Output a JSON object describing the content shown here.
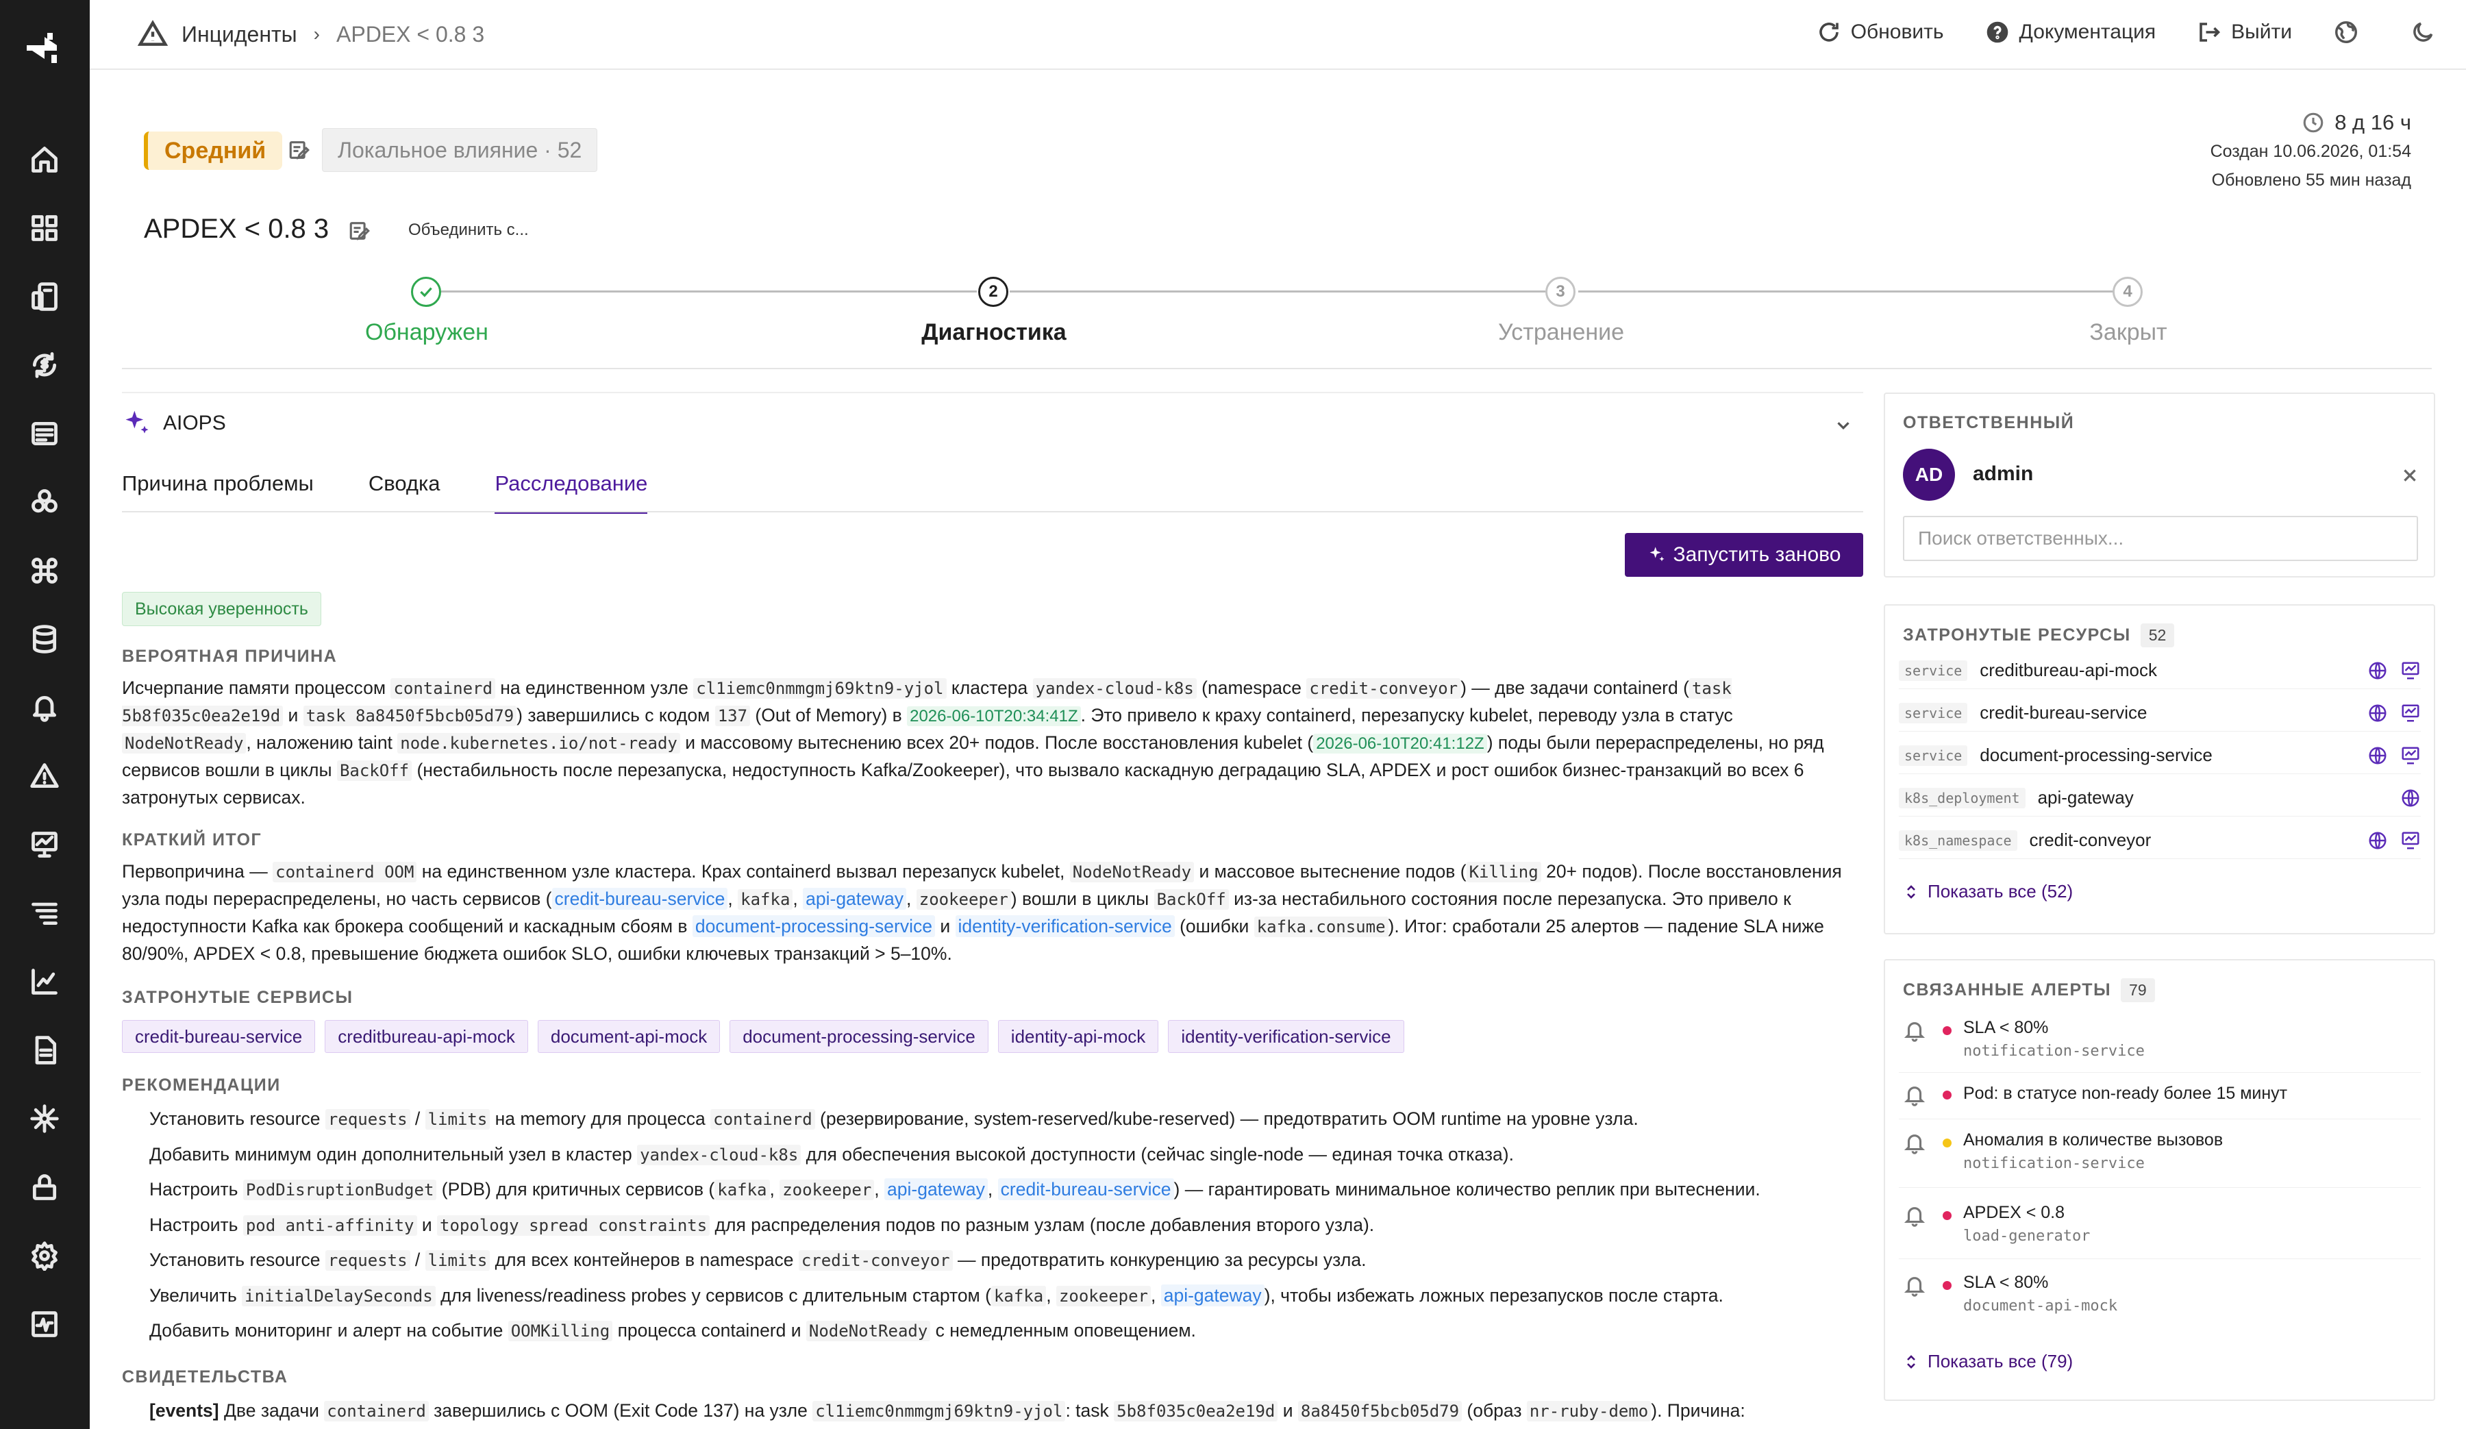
{
  "breadcrumb": {
    "section": "Инциденты",
    "current": "APDEX < 0.8 3"
  },
  "topbar": {
    "refresh": "Обновить",
    "docs": "Документация",
    "logout": "Выйти"
  },
  "incident": {
    "severity": "Средний",
    "impact": "Локальное влияние · 52",
    "title": "APDEX < 0.8 3",
    "merge": "Объединить с...",
    "duration": "8 д 16 ч",
    "created": "Создан 10.06.2026, 01:54",
    "updated": "Обновлено 55 мин назад"
  },
  "stepper": [
    {
      "num": "",
      "label": "Обнаружен",
      "state": "done"
    },
    {
      "num": "2",
      "label": "Диагностика",
      "state": "active"
    },
    {
      "num": "3",
      "label": "Устранение",
      "state": "pending"
    },
    {
      "num": "4",
      "label": "Закрыт",
      "state": "pending"
    }
  ],
  "aiops": {
    "title": "AIOPS",
    "tabs": [
      "Причина проблемы",
      "Сводка",
      "Расследование"
    ],
    "active_tab": "Расследование",
    "rerun": "Запустить заново",
    "confidence": "Высокая уверенность",
    "cause_heading": "ВЕРОЯТНАЯ ПРИЧИНА",
    "cause": {
      "t1": "Исчерпание памяти процессом ",
      "c1": "containerd",
      "t2": " на единственном узле ",
      "c2": "cl1iemc0nmmgmj69ktn9-yjol",
      "t3": " кластера ",
      "c3": "yandex-cloud-k8s",
      "t4": " (namespace ",
      "c4": "credit-conveyor",
      "t5": ") — две задачи containerd (",
      "c5": "task 5b8f035c0ea2e19d",
      "t6": " и ",
      "c6": "task 8a8450f5bcb05d79",
      "t7": ") завершились с кодом ",
      "c7": "137",
      "t8": " (Out of Memory) в ",
      "ts1": "2026-06-10T20:34:41Z",
      "t9": ". Это привело к краху containerd, перезапуску kubelet, переводу узла в статус ",
      "c8": "NodeNotReady",
      "t10": ", наложению taint ",
      "c9": "node.kubernetes.io/not-ready",
      "t11": " и массовому вытеснению всех 20+ подов. После восстановления kubelet (",
      "ts2": "2026-06-10T20:41:12Z",
      "t12": ") поды были перераспределены, но ряд сервисов вошли в циклы ",
      "c10": "BackOff",
      "t13": " (нестабильность после перезапуска, недоступность Kafka/Zookeeper), что вызвало каскадную деградацию SLA, APDEX и рост ошибок бизнес-транзакций во всех 6 затронутых сервисах."
    },
    "summary_heading": "КРАТКИЙ ИТОГ",
    "summary": {
      "t1": "Первопричина — ",
      "c1": "containerd OOM",
      "t2": " на единственном узле кластера. Крах containerd вызвал перезапуск kubelet, ",
      "c2": "NodeNotReady",
      "t3": " и массовое вытеснение подов (",
      "c3": "Killing",
      "t4": " 20+ подов). После восстановления узла поды перераспределены, но часть сервисов (",
      "l1": "credit-bureau-service",
      "t5": ", ",
      "c4": "kafka",
      "t6": ", ",
      "l2": "api-gateway",
      "t7": ", ",
      "c5": "zookeeper",
      "t8": ") вошли в циклы ",
      "c6": "BackOff",
      "t9": " из-за нестабильного состояния после перезапуска. Это привело к недоступности Kafka как брокера сообщений и каскадным сбоям в ",
      "l3": "document-processing-service",
      "t10": " и ",
      "l4": "identity-verification-service",
      "t11": " (ошибки ",
      "c7": "kafka.consume",
      "t12": "). Итог: сработали 25 алертов — падение SLA ниже 80/90%, APDEX < 0.8, превышение бюджета ошибок SLO, ошибки ключевых транзакций > 5–10%."
    },
    "services_heading": "ЗАТРОНУТЫЕ СЕРВИСЫ",
    "services": [
      "credit-bureau-service",
      "creditbureau-api-mock",
      "document-api-mock",
      "document-processing-service",
      "identity-api-mock",
      "identity-verification-service"
    ],
    "rec_heading": "РЕКОМЕНДАЦИИ",
    "recs": {
      "r1": {
        "t1": "Установить resource ",
        "c1": "requests",
        "t2": " / ",
        "c2": "limits",
        "t3": " на memory для процесса ",
        "c3": "containerd",
        "t4": " (резервирование, system-reserved/kube-reserved) — предотвратить OOM runtime на уровне узла."
      },
      "r2": {
        "t1": "Добавить минимум один дополнительный узел в кластер ",
        "c1": "yandex-cloud-k8s",
        "t2": " для обеспечения высокой доступности (сейчас single-node — единая точка отказа)."
      },
      "r3": {
        "t1": "Настроить ",
        "c1": "PodDisruptionBudget",
        "t2": " (PDB) для критичных сервисов (",
        "c2": "kafka",
        "t3": ", ",
        "c3": "zookeeper",
        "t4": ", ",
        "l1": "api-gateway",
        "t5": ", ",
        "l2": "credit-bureau-service",
        "t6": ") — гарантировать минимальное количество реплик при вытеснении."
      },
      "r4": {
        "t1": "Настроить ",
        "c1": "pod anti-affinity",
        "t2": " и ",
        "c2": "topology spread constraints",
        "t3": " для распределения подов по разным узлам (после добавления второго узла)."
      },
      "r5": {
        "t1": "Установить resource ",
        "c1": "requests",
        "t2": " / ",
        "c2": "limits",
        "t3": " для всех контейнеров в namespace ",
        "c3": "credit-conveyor",
        "t4": " — предотвратить конкуренцию за ресурсы узла."
      },
      "r6": {
        "t1": "Увеличить ",
        "c1": "initialDelaySeconds",
        "t2": " для liveness/readiness probes у сервисов с длительным стартом (",
        "c2": "kafka",
        "t3": ", ",
        "c3": "zookeeper",
        "t4": ", ",
        "l1": "api-gateway",
        "t5": "), чтобы избежать ложных перезапусков после старта."
      },
      "r7": {
        "t1": "Добавить мониторинг и алерт на событие ",
        "c1": "OOMKilling",
        "t2": " процесса containerd и ",
        "c2": "NodeNotReady",
        "t3": " с немедленным оповещением."
      }
    },
    "evidence_heading": "СВИДЕТЕЛЬСТВА",
    "evidence": {
      "tag": "[events]",
      "t1": " Две задачи ",
      "c1": "containerd",
      "t2": " завершились с OOM (Exit Code 137) на узле ",
      "c2": "cl1iemc0nmmgmj69ktn9-yjol",
      "t3": ": task ",
      "c3": "5b8f035c0ea2e19d",
      "t4": " и ",
      "c4": "8a8450f5bcb05d79",
      "t5": " (образ ",
      "c5": "nr-ruby-demo",
      "t6": "). Причина:"
    }
  },
  "responsible": {
    "heading": "ОТВЕТСТВЕННЫЙ",
    "initials": "AD",
    "name": "admin",
    "search_placeholder": "Поиск ответственных..."
  },
  "resources": {
    "heading": "ЗАТРОНУТЫЕ РЕСУРСЫ",
    "count": "52",
    "items": [
      {
        "type": "service",
        "name": "creditbureau-api-mock"
      },
      {
        "type": "service",
        "name": "credit-bureau-service"
      },
      {
        "type": "service",
        "name": "document-processing-service"
      },
      {
        "type": "k8s_deployment",
        "name": "api-gateway"
      },
      {
        "type": "k8s_namespace",
        "name": "credit-conveyor"
      }
    ],
    "show_all": "Показать все (52)"
  },
  "alerts": {
    "heading": "СВЯЗАННЫЕ АЛЕРТЫ",
    "count": "79",
    "items": [
      {
        "title": "SLA < 80%",
        "source": "notification-service",
        "color": "#e0245e"
      },
      {
        "title": "Pod: в статусе non-ready более 15 минут",
        "source": "",
        "color": "#e0245e"
      },
      {
        "title": "Аномалия в количестве вызовов",
        "source": "notification-service",
        "color": "#f5c518"
      },
      {
        "title": "APDEX < 0.8",
        "source": "load-generator",
        "color": "#e0245e"
      },
      {
        "title": "SLA < 80%",
        "source": "document-api-mock",
        "color": "#e0245e"
      }
    ],
    "show_all": "Показать все (79)"
  },
  "colors": {
    "accent": "#44107a",
    "sidebar": "#1c1c1c",
    "success": "#2fa84f",
    "warning": "#e5a600"
  }
}
